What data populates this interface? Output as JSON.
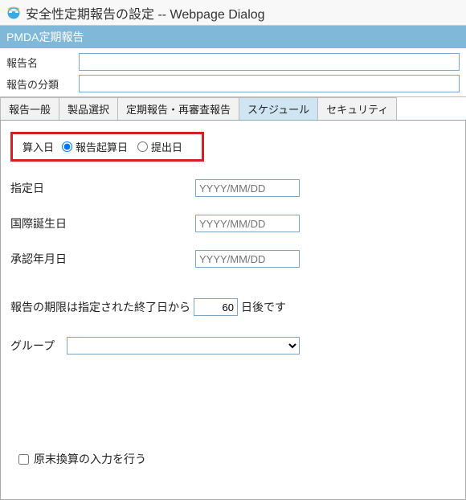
{
  "window": {
    "title": "安全性定期報告の設定 -- Webpage Dialog"
  },
  "section": {
    "title": "PMDA定期報告"
  },
  "topform": {
    "report_name_label": "報告名",
    "report_name_value": "",
    "report_class_label": "報告の分類",
    "report_class_value": ""
  },
  "tabs": {
    "t0": "報告一般",
    "t1": "製品選択",
    "t2": "定期報告・再審査報告",
    "t3": "スケジュール",
    "t4": "セキュリティ"
  },
  "schedule": {
    "calc_group_label": "算入日",
    "calc_opt1_label": "報告起算日",
    "calc_opt2_label": "提出日",
    "specified_date_label": "指定日",
    "specified_date_placeholder": "YYYY/MM/DD",
    "intl_birthday_label": "国際誕生日",
    "intl_birthday_placeholder": "YYYY/MM/DD",
    "approval_date_label": "承認年月日",
    "approval_date_placeholder": "YYYY/MM/DD",
    "deadline_prefix": "報告の期限は指定された終了日から",
    "deadline_days_value": "60",
    "deadline_suffix": "日後です",
    "group_label": "グループ",
    "group_value": "",
    "rawcalc_label": "原末換算の入力を行う"
  }
}
